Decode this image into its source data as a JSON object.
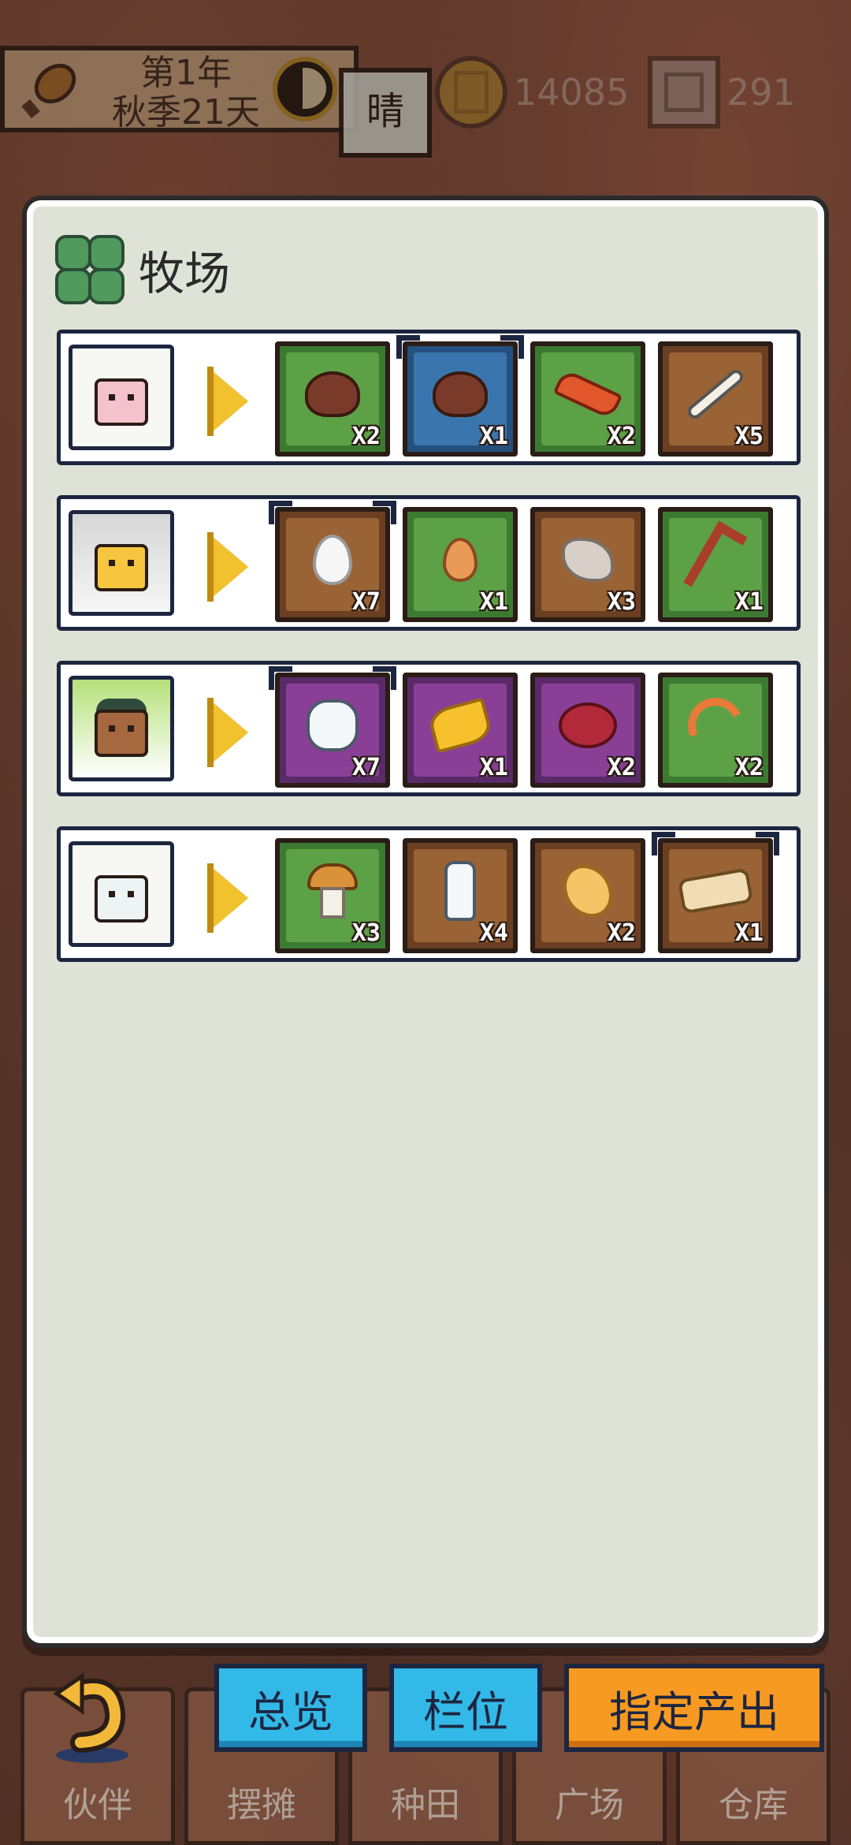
{
  "hud": {
    "date_line1": "第1年",
    "date_line2": "秋季21天",
    "weather": "晴",
    "gold": "14085",
    "silver": "291"
  },
  "panel": {
    "title": "牧场",
    "icon": "clover-icon",
    "rows": [
      {
        "animal": "pig",
        "items": [
          {
            "icon": "nut-icon",
            "qty": "X2",
            "frame": "green"
          },
          {
            "icon": "nut-icon",
            "qty": "X1",
            "frame": "blue",
            "selected": true
          },
          {
            "icon": "bacon-icon",
            "qty": "X2",
            "frame": "green"
          },
          {
            "icon": "bone-icon",
            "qty": "X5",
            "frame": "brown"
          }
        ]
      },
      {
        "animal": "chick",
        "items": [
          {
            "icon": "white-egg-icon",
            "qty": "X7",
            "frame": "brown",
            "selected": true
          },
          {
            "icon": "brown-egg-icon",
            "qty": "X1",
            "frame": "green"
          },
          {
            "icon": "feather-icon",
            "qty": "X3",
            "frame": "brown"
          },
          {
            "icon": "drumstick-icon",
            "qty": "X1",
            "frame": "green"
          }
        ]
      },
      {
        "animal": "brown-cow",
        "items": [
          {
            "icon": "milk-jar-icon",
            "qty": "X7",
            "frame": "purple",
            "selected": true
          },
          {
            "icon": "cheese-icon",
            "qty": "X1",
            "frame": "purple"
          },
          {
            "icon": "steak-icon",
            "qty": "X2",
            "frame": "purple"
          },
          {
            "icon": "worm-icon",
            "qty": "X2",
            "frame": "green"
          }
        ]
      },
      {
        "animal": "white-cow",
        "items": [
          {
            "icon": "mushroom-icon",
            "qty": "X3",
            "frame": "green"
          },
          {
            "icon": "milk-bottle-icon",
            "qty": "X4",
            "frame": "brown"
          },
          {
            "icon": "butter-icon",
            "qty": "X2",
            "frame": "brown"
          },
          {
            "icon": "bread-icon",
            "qty": "X1",
            "frame": "brown",
            "selected": true
          }
        ]
      }
    ]
  },
  "buttons": {
    "overview": "总览",
    "slots": "栏位",
    "specify_output": "指定产出"
  },
  "nav": {
    "partner": "伙伴",
    "stall": "摆摊",
    "farm": "种田",
    "plaza": "广场",
    "warehouse": "仓库"
  },
  "colors": {
    "button_blue": "#33b9e8",
    "button_orange": "#f79a22",
    "panel_bg": "#dfe2d6"
  }
}
